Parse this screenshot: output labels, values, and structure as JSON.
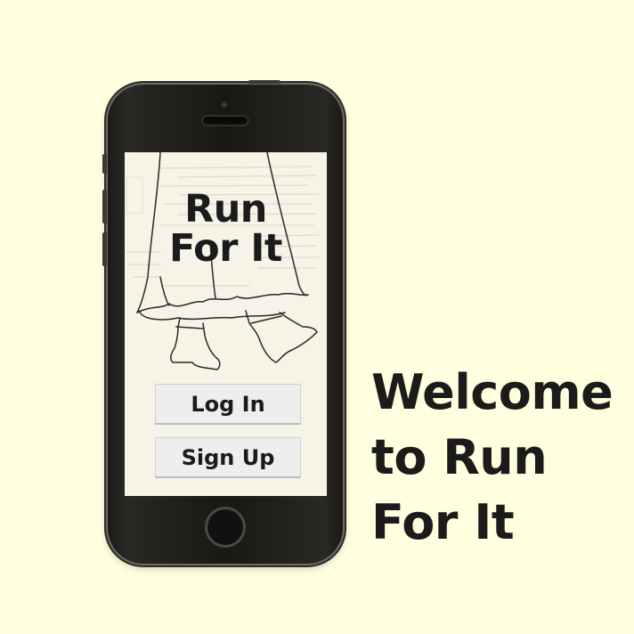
{
  "app": {
    "title_line1": "Run",
    "title_line2": "For It"
  },
  "buttons": {
    "login_label": "Log In",
    "signup_label": "Sign Up"
  },
  "caption": {
    "line1": "Welcome",
    "line2": "to Run",
    "line3": "For It"
  },
  "colors": {
    "background": "#fffede",
    "phone_body": "#1c1a17",
    "screen": "#f6f3e7",
    "button": "#eeeeee",
    "text": "#1b1b1b"
  }
}
